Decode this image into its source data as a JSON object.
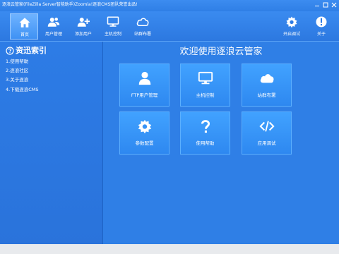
{
  "window": {
    "title": "逐浪云管家(FileZilla Server智能助手)Zoomla!逐浪CMS团队荣誉出品!"
  },
  "toolbar": {
    "items": [
      {
        "label": "首页",
        "icon": "home-icon"
      },
      {
        "label": "用户管理",
        "icon": "users-icon"
      },
      {
        "label": "添加用户",
        "icon": "add-user-icon"
      },
      {
        "label": "主机控制",
        "icon": "monitor-icon"
      },
      {
        "label": "站群布署",
        "icon": "cloud-icon"
      },
      {
        "label": "开启调试",
        "icon": "gear-icon"
      },
      {
        "label": "关于",
        "icon": "info-icon"
      }
    ]
  },
  "sidebar": {
    "title": "资迅索引",
    "items": [
      {
        "label": "1.使用帮助"
      },
      {
        "label": "2.逐浪社区"
      },
      {
        "label": "3.关于逐浪"
      },
      {
        "label": "4.下载逐浪CMS"
      }
    ]
  },
  "main": {
    "heading": "欢迎使用逐浪云管家",
    "tiles": [
      {
        "label": "FTP用户管理",
        "icon": "user-icon"
      },
      {
        "label": "主机控制",
        "icon": "monitor-icon"
      },
      {
        "label": "站群布署",
        "icon": "cloud-icon"
      },
      {
        "label": "参数配置",
        "icon": "gear-icon"
      },
      {
        "label": "使用帮助",
        "icon": "question-icon"
      },
      {
        "label": "应用调试",
        "icon": "code-icon"
      }
    ]
  }
}
